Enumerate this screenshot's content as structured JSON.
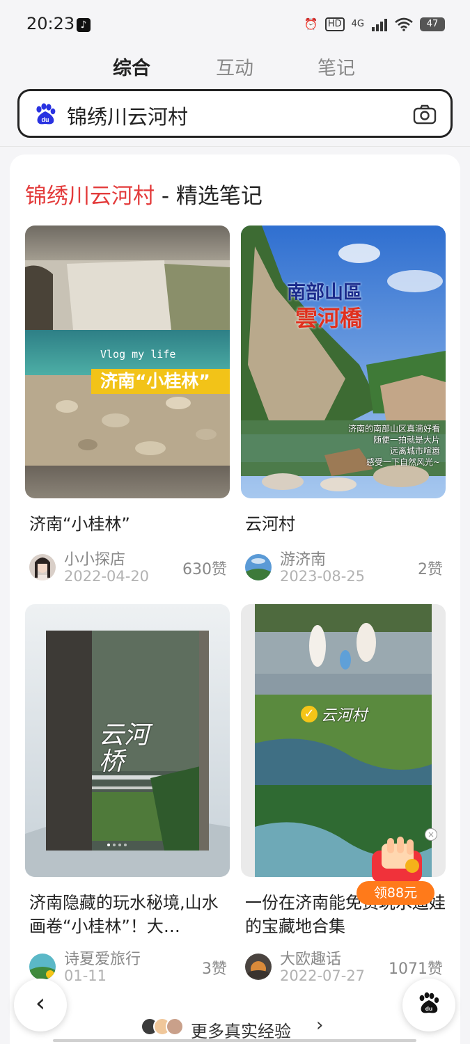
{
  "status_bar": {
    "time": "20:23",
    "network": "4G",
    "battery": "47"
  },
  "tabs": [
    {
      "label": "综合",
      "active": true
    },
    {
      "label": "互动",
      "active": false
    },
    {
      "label": "笔记",
      "active": false
    }
  ],
  "search": {
    "query": "锦绣川云河村"
  },
  "section": {
    "title_highlight": "锦绣川云河村",
    "title_rest": " - 精选笔记"
  },
  "notes": [
    {
      "title": "济南“小桂林”",
      "author": "小小探店",
      "date": "2022-04-20",
      "likes": "630赞",
      "image_text": [
        "Vlog my life",
        "济南“小桂林”"
      ]
    },
    {
      "title": "云河村",
      "author": "游济南",
      "date": "2023-08-25",
      "likes": "2赞",
      "image_text": [
        "南部山區",
        "雲河橋",
        "济南的南部山区真滴好看",
        "随便一拍就是大片",
        "远离城市喧嚣",
        "感受一下自然风光~"
      ]
    },
    {
      "title": "济南隐藏的玩水秘境,山水画卷“小桂林”！大…",
      "author": "诗夏爱旅行",
      "date": "01-11",
      "likes": "3赞",
      "image_text": [
        "云河桥"
      ]
    },
    {
      "title": "一份在济南能免费玩水遛娃的宝藏地合集",
      "author": "大欧趣话",
      "date": "2022-07-27",
      "likes": "1071赞",
      "image_text": [
        "云河村"
      ]
    }
  ],
  "promo": {
    "label": "领88元"
  },
  "more": {
    "label": "更多真实经验"
  },
  "colors": {
    "accent": "#e33b3b",
    "promo": "#ff7a1a",
    "baidu_blue": "#2932e1"
  }
}
